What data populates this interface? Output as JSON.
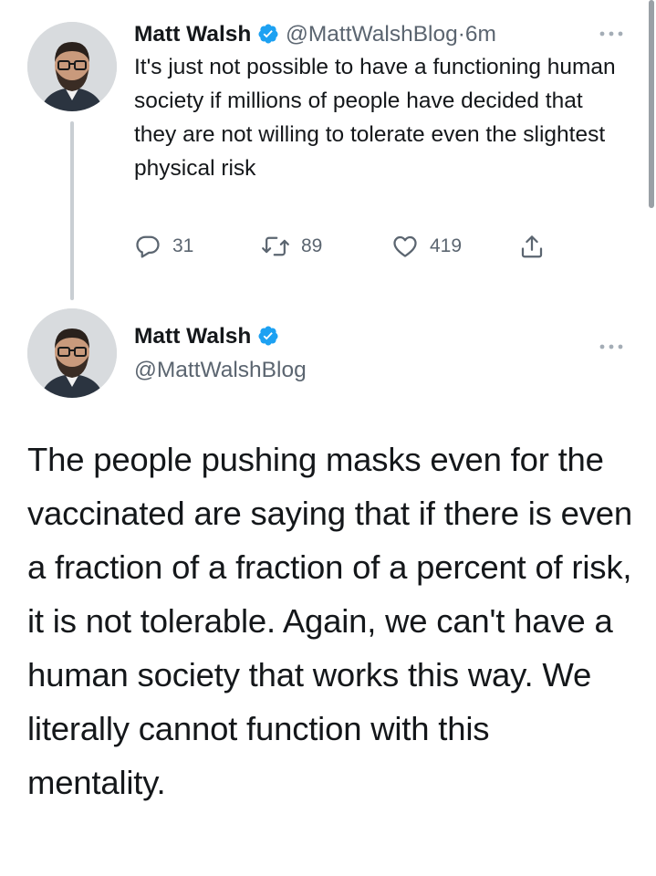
{
  "reply_tweet": {
    "author_name": "Matt Walsh",
    "handle": "@MattWalshBlog",
    "separator": "·",
    "time": "6m",
    "text": "It's just not possible to have a functioning human society if millions of people have decided that they are not willing to tolerate even the slightest physical risk",
    "replies": "31",
    "retweets": "89",
    "likes": "419"
  },
  "main_tweet": {
    "author_name": "Matt Walsh",
    "handle": "@MattWalshBlog",
    "text": "The people pushing masks even for the vaccinated are saying that if there is even a fraction of a fraction of a percent of risk, it is not tolerable. Again, we can't have a human society that works this way. We literally cannot function with this mentality."
  },
  "icons": {
    "verified": "verified-badge-icon",
    "more": "more-options-icon",
    "reply": "reply-icon",
    "retweet": "retweet-icon",
    "like": "like-icon",
    "share": "share-icon"
  },
  "colors": {
    "verified": "#1da1f2",
    "text": "#14171a",
    "secondary": "#5b6570",
    "thread_line": "#c9ced3"
  }
}
